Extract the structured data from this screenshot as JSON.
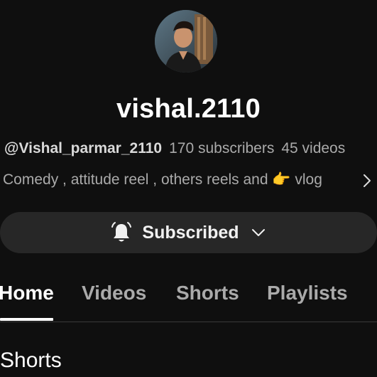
{
  "channel": {
    "name": "vishal.2110",
    "handle": "@Vishal_parmar_2110",
    "subscribers": "170 subscribers",
    "videos": "45 videos",
    "description": "Comedy , attitude reel , others reels and 👉 vlog"
  },
  "subscribe": {
    "label": "Subscribed",
    "icon": "bell-icon"
  },
  "tabs": [
    {
      "label": "Home",
      "active": true
    },
    {
      "label": "Videos",
      "active": false
    },
    {
      "label": "Shorts",
      "active": false
    },
    {
      "label": "Playlists",
      "active": false
    }
  ],
  "sections": {
    "shorts_title": "Shorts"
  },
  "colors": {
    "background": "#0f0f0f",
    "button_bg": "#272727",
    "text_primary": "#ffffff",
    "text_secondary": "#aaaaaa"
  }
}
